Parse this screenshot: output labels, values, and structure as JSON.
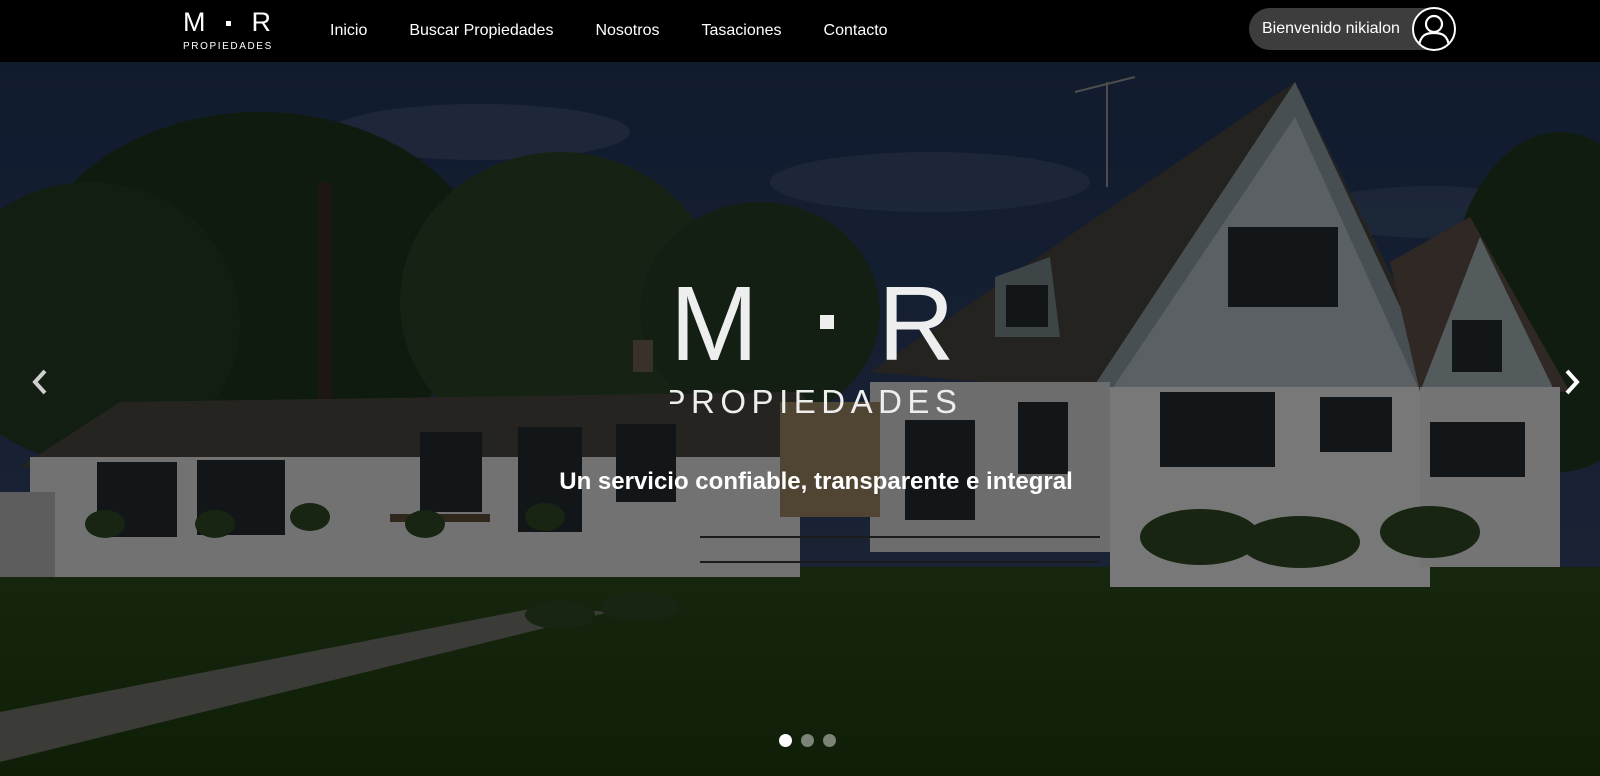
{
  "brand": {
    "mark_left": "M",
    "mark_right": "R",
    "word": "PROPIEDADES"
  },
  "nav": {
    "items": [
      {
        "label": "Inicio"
      },
      {
        "label": "Buscar Propiedades"
      },
      {
        "label": "Nosotros"
      },
      {
        "label": "Tasaciones"
      },
      {
        "label": "Contacto"
      }
    ],
    "user_greeting": "Bienvenido nikialon",
    "user_icon": "user-icon"
  },
  "hero": {
    "logo_left": "M",
    "logo_right": "R",
    "logo_word": "PROPIEDADES",
    "tagline": "Un servicio confiable, transparente e integral",
    "prev_icon": "chevron-left-icon",
    "next_icon": "chevron-right-icon",
    "slide_count": 3,
    "active_slide": 1
  },
  "colors": {
    "navbar": "#000000",
    "pill": "#3d3d3d",
    "text": "#ffffff"
  }
}
